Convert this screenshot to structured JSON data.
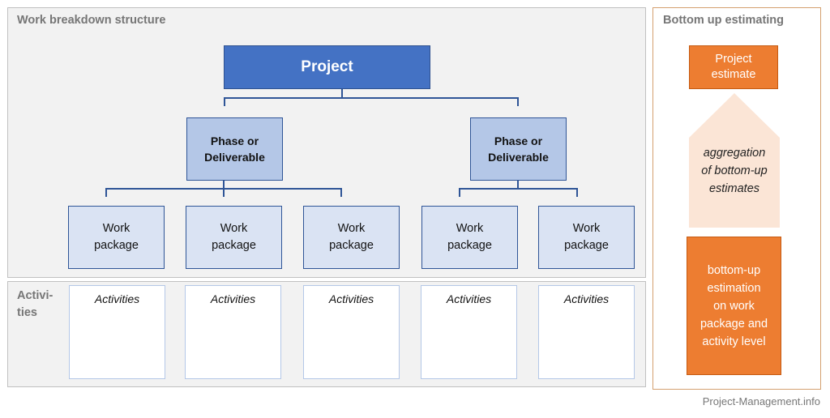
{
  "wbs": {
    "title": "Work breakdown structure",
    "project": "Project",
    "phases": [
      {
        "line1": "Phase or",
        "line2": "Deliverable"
      },
      {
        "line1": "Phase or",
        "line2": "Deliverable"
      }
    ],
    "work_packages": [
      {
        "line1": "Work",
        "line2": "package"
      },
      {
        "line1": "Work",
        "line2": "package"
      },
      {
        "line1": "Work",
        "line2": "package"
      },
      {
        "line1": "Work",
        "line2": "package"
      },
      {
        "line1": "Work",
        "line2": "package"
      }
    ]
  },
  "activities": {
    "label_line1": "Activi-",
    "label_line2": "ties",
    "boxes": [
      "Activities",
      "Activities",
      "Activities",
      "Activities",
      "Activities"
    ]
  },
  "bottom_up": {
    "title": "Bottom up estimating",
    "project_estimate": {
      "line1": "Project",
      "line2": "estimate"
    },
    "aggregation": {
      "line1": "aggregation",
      "line2": "of bottom-up",
      "line3": "estimates"
    },
    "estimation": {
      "line1": "bottom-up",
      "line2": "estimation",
      "line3": "on work",
      "line4": "package and",
      "line5": "activity level"
    },
    "arrow_icon": "up-arrow-shape"
  },
  "footer": {
    "credit": "Project-Management.info"
  },
  "colors": {
    "project_blue": "#4472c4",
    "phase_blue": "#b4c7e7",
    "work_package_blue": "#dae3f3",
    "connector_blue": "#2f5597",
    "orange": "#ed7d31",
    "arrow_fill": "#fbe5d6",
    "panel_gray": "#f2f2f2"
  }
}
